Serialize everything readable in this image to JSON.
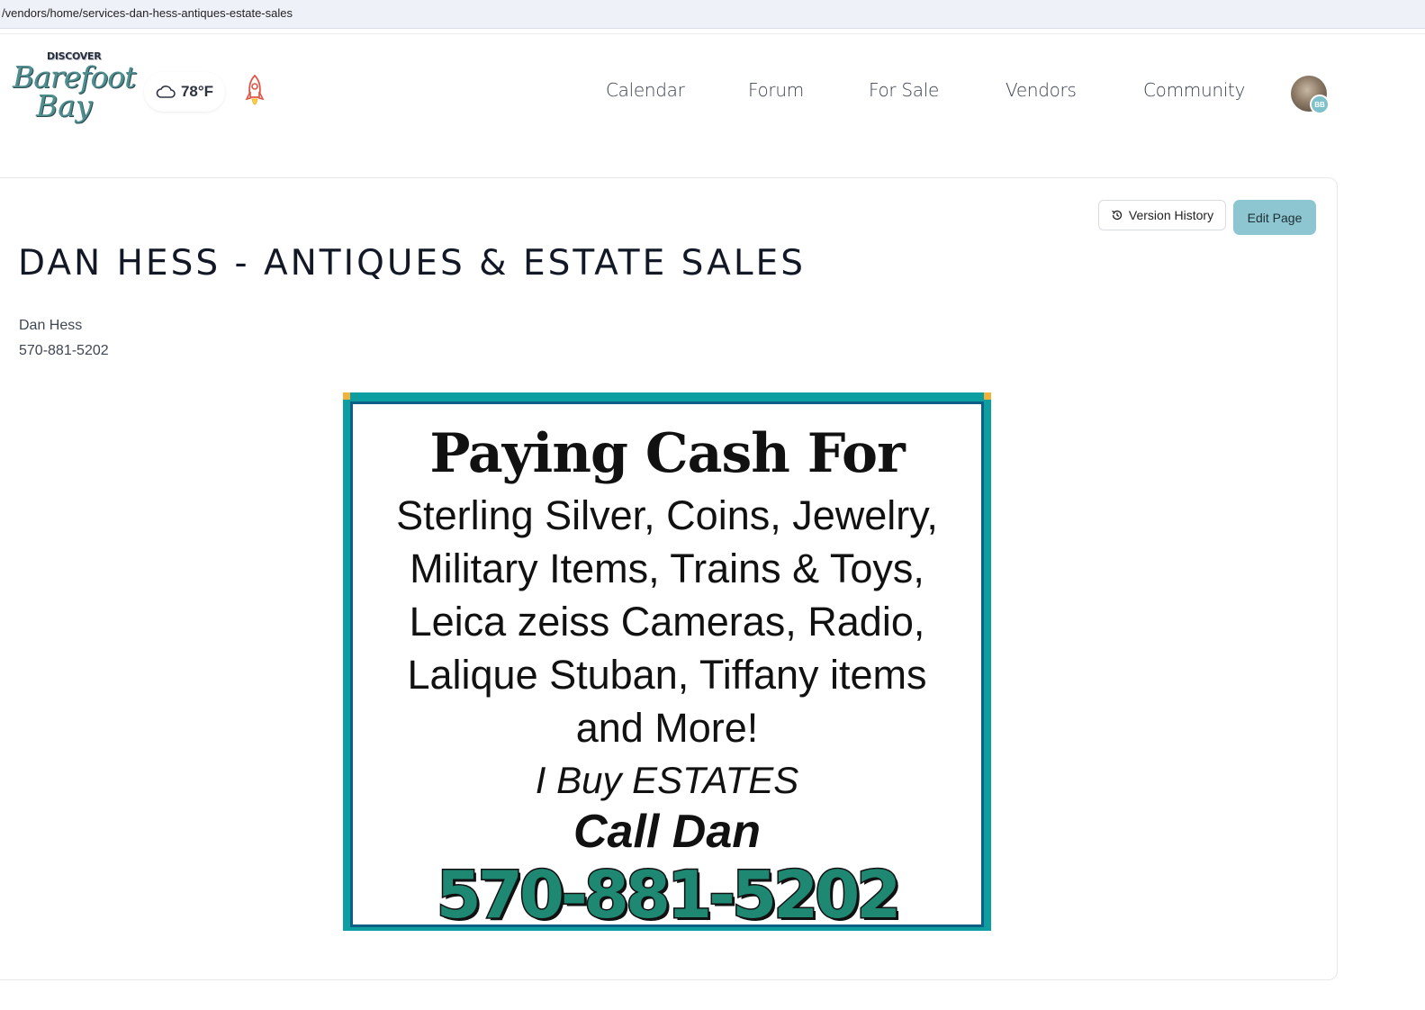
{
  "url": "/vendors/home/services-dan-hess-antiques-estate-sales",
  "header": {
    "logo": {
      "top": "DISCOVER",
      "line1": "Barefoot",
      "line2": "Bay"
    },
    "weather": {
      "temp": "78°F",
      "icon": "cloud-icon"
    },
    "rocket_icon": "rocket-icon",
    "nav": [
      "Calendar",
      "Forum",
      "For Sale",
      "Vendors",
      "Community"
    ],
    "avatar_badge": "BB"
  },
  "page": {
    "version_history_label": "Version History",
    "edit_label": "Edit Page",
    "title": "DAN HESS - ANTIQUES & ESTATE SALES",
    "contact_name": "Dan Hess",
    "contact_phone": "570-881-5202"
  },
  "ad": {
    "headline": "Paying Cash For",
    "lines": [
      "Sterling Silver, Coins, Jewelry,",
      "Military Items, Trains & Toys,",
      "Leica zeiss Cameras, Radio,",
      "Lalique Stuban, Tiffany items",
      "and More!"
    ],
    "estates": "I Buy ESTATES",
    "call": "Call Dan",
    "phone": "570-881-5202"
  },
  "colors": {
    "accent": "#8dc6d0",
    "ad_border": "#0c9ea1",
    "phone_green": "#1f8873"
  }
}
